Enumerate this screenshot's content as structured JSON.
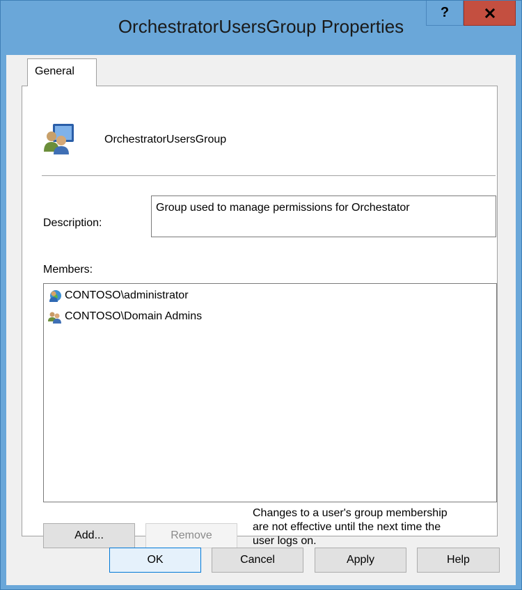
{
  "window": {
    "title": "OrchestratorUsersGroup Properties",
    "help_button": "?",
    "colors": {
      "titlebar": "#6aa7d9",
      "close": "#c44f40"
    }
  },
  "tabs": [
    {
      "label": "General",
      "selected": true
    }
  ],
  "general": {
    "group_name": "OrchestratorUsersGroup",
    "group_icon": "group-users-icon",
    "description_label": "Description:",
    "description_value": "Group used to manage permissions for Orchestator",
    "members_label": "Members:",
    "members": [
      {
        "name": "CONTOSO\\administrator",
        "icon": "user-icon"
      },
      {
        "name": "CONTOSO\\Domain Admins",
        "icon": "group-icon"
      }
    ],
    "add_label": "Add...",
    "remove_label": "Remove",
    "note_lines": [
      "Changes to a user's group membership",
      "are not effective until the next time the",
      "user logs on."
    ]
  },
  "footer": {
    "ok_label": "OK",
    "cancel_label": "Cancel",
    "apply_label": "Apply",
    "help_label": "Help"
  }
}
